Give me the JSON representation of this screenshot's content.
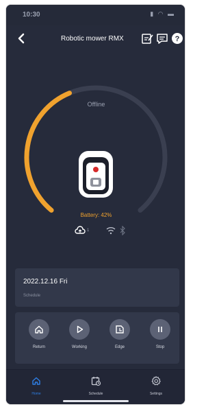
{
  "status_bar": {
    "time": "10:30",
    "icons": "▮ ◠ ▬"
  },
  "header": {
    "title": "Robotic mower RMX"
  },
  "gauge": {
    "status": "Offline",
    "battery_text": "Battery: 42%",
    "battery_level": 0.42,
    "connection_count": "1"
  },
  "colors": {
    "accent": "#f0a22e",
    "track": "#3a3f50",
    "tab_active": "#2f7fe5",
    "tab_inactive": "#c9ccd6"
  },
  "schedule_card": {
    "date": "2022.12.16 Fri",
    "subtitle": "Schedule"
  },
  "controls": [
    {
      "label": "Return",
      "icon": "home-icon"
    },
    {
      "label": "Working",
      "icon": "play-icon"
    },
    {
      "label": "Edge",
      "icon": "edge-icon"
    },
    {
      "label": "Stop",
      "icon": "pause-icon"
    }
  ],
  "tabs": [
    {
      "label": "Home",
      "icon": "home-icon",
      "active": true
    },
    {
      "label": "Schedule",
      "icon": "calendar-icon",
      "active": false
    },
    {
      "label": "Settings",
      "icon": "gear-icon",
      "active": false
    }
  ]
}
